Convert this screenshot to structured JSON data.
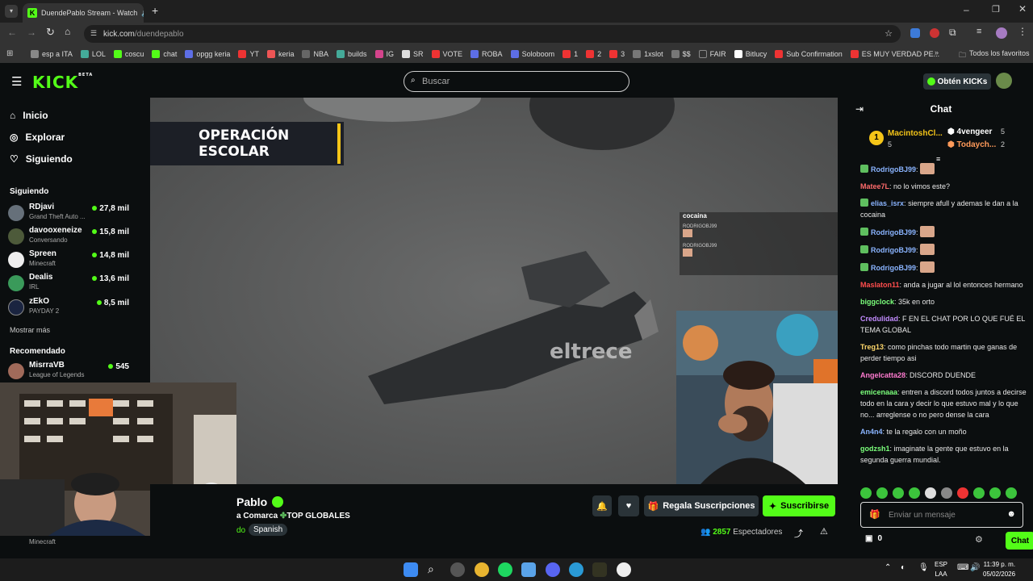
{
  "browser": {
    "tab_title": "DuendePablo Stream - Watch",
    "url_host": "kick.com",
    "url_path": "/duendepablo",
    "bookmarks": [
      "esp a ITA",
      "LOL",
      "coscu",
      "chat",
      "opgg keria",
      "YT",
      "keria",
      "NBA",
      "builds",
      "IG",
      "SR",
      "VOTE",
      "ROBA",
      "Soloboom",
      "1",
      "2",
      "3",
      "1xslot",
      "$$",
      "FAIR",
      "Bitlucy",
      "Sub Confirmation",
      "ES MUY VERDAD PE..."
    ],
    "all_favorites": "Todos los favoritos"
  },
  "kick": {
    "logo": "KICK",
    "logo_badge": "BETA",
    "search_placeholder": "Buscar",
    "get_kicks": "Obtén KICKs"
  },
  "sidebar": {
    "nav": [
      {
        "label": "Inicio",
        "icon": "home-icon"
      },
      {
        "label": "Explorar",
        "icon": "compass-icon"
      },
      {
        "label": "Siguiendo",
        "icon": "heart-icon"
      }
    ],
    "following_title": "Siguiendo",
    "following": [
      {
        "name": "RDjavi",
        "category": "Grand Theft Auto ...",
        "viewers": "27,8 mil"
      },
      {
        "name": "davooxeneize",
        "category": "Conversando",
        "viewers": "15,8 mil"
      },
      {
        "name": "Spreen",
        "category": "Minecraft",
        "viewers": "14,8 mil"
      },
      {
        "name": "Dealis",
        "category": "IRL",
        "viewers": "13,6 mil"
      },
      {
        "name": "zEkO",
        "category": "PAYDAY 2",
        "viewers": "8,5 mil"
      }
    ],
    "show_more": "Mostrar más",
    "recommended_title": "Recomendado",
    "recommended": [
      {
        "name": "MisrraVB",
        "category": "League of Legends",
        "viewers": "545"
      }
    ],
    "partial_category": "Minecraft"
  },
  "video": {
    "banner_text": "OPERACIÓN ESCOLAR",
    "watermark": "eltrece",
    "overlay_title": "cocaina",
    "overlay_user1": "RODRIGOBJ99",
    "overlay_user2": "RODRIGOBJ99"
  },
  "stream": {
    "name": "Pablo",
    "title_line": "a Comarca",
    "title_suffix": "TOP GLOBALES",
    "category_partial": "do",
    "tag": "Spanish",
    "gift_subs": "Regala Suscripciones",
    "subscribe": "Suscribirse",
    "viewers_count": "2857",
    "viewers_label": "Espectadores"
  },
  "chat": {
    "title": "Chat",
    "leaderboard": [
      {
        "rank": "1",
        "name": "MacintoshCl...",
        "count": "5"
      },
      {
        "name": "4vengeer",
        "count": "5"
      },
      {
        "name": "Todaych...",
        "count": "2"
      }
    ],
    "messages": [
      {
        "user": "RodrigoBJ99",
        "color": "#8ab4ff",
        "text": "",
        "emote": true,
        "badge": true
      },
      {
        "user": "Matee7L",
        "color": "#ff6b6b",
        "text": "no lo vimos este?",
        "emote": false,
        "badge": false
      },
      {
        "user": "elias_isrx",
        "color": "#8ab4ff",
        "text": "siempre afull y ademas le dan a la cocaina",
        "emote": false,
        "badge": true
      },
      {
        "user": "RodrigoBJ99",
        "color": "#8ab4ff",
        "text": "",
        "emote": true,
        "badge": true
      },
      {
        "user": "RodrigoBJ99",
        "color": "#8ab4ff",
        "text": "",
        "emote": true,
        "badge": true
      },
      {
        "user": "RodrigoBJ99",
        "color": "#8ab4ff",
        "text": "",
        "emote": true,
        "badge": true
      },
      {
        "user": "Maslaton11",
        "color": "#ff4d4d",
        "text": "anda a jugar al lol entonces hermano",
        "emote": false,
        "badge": false
      },
      {
        "user": "biggclock",
        "color": "#7bff7b",
        "text": "35k en orto",
        "emote": false,
        "badge": false
      },
      {
        "user": "Credulidad",
        "color": "#c38cff",
        "text": "F EN EL CHAT POR LO QUE FUÉ EL TEMA GLOBAL",
        "emote": false,
        "badge": false
      },
      {
        "user": "Treg13",
        "color": "#ffd86b",
        "text": "como pinchas todo martin que ganas de perder tiempo asi",
        "emote": false,
        "badge": false
      },
      {
        "user": "Angelcatta28",
        "color": "#ff7bd0",
        "text": "DISCORD DUENDE",
        "emote": false,
        "badge": false
      },
      {
        "user": "emicenaaa",
        "color": "#7bff7b",
        "text": "entren a discord todos juntos a decirse todo en la cara y decir lo que estuvo mal y lo que no... arreglense o no pero dense la cara",
        "emote": false,
        "badge": false
      },
      {
        "user": "An4n4",
        "color": "#8ab4ff",
        "text": "te la regalo con un moño",
        "emote": false,
        "badge": false
      },
      {
        "user": "godzsh1",
        "color": "#7bff7b",
        "text": "imaginate la gente que estuvo en la segunda guerra mundial.",
        "emote": false,
        "badge": false
      }
    ],
    "input_placeholder": "Enviar un mensaje",
    "kicks_count": "0",
    "send_label": "Chat"
  },
  "taskbar": {
    "lang_line1": "ESP",
    "lang_line2": "LAA",
    "time": "11:39 p. m.",
    "date": "05/02/2026"
  }
}
